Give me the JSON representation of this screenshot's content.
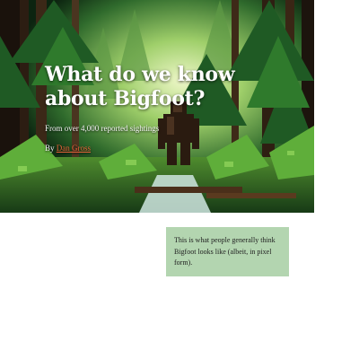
{
  "hero": {
    "title": "What do we know about Bigfoot?",
    "subtitle": "From over 4,000 reported sightings",
    "byline_prefix": "By",
    "author": "Dan Gross"
  },
  "caption": {
    "text": "This is what people generally think Bigfoot looks like (albeit, in pixel form)."
  },
  "colors": {
    "link": "#e8643a",
    "caption_bg": "#b3d5b0",
    "forest_dark": "#0b1f0e",
    "forest_light": "#cfe8a0"
  },
  "icons": {
    "hero_image": "pixel-forest-bigfoot-illustration"
  }
}
